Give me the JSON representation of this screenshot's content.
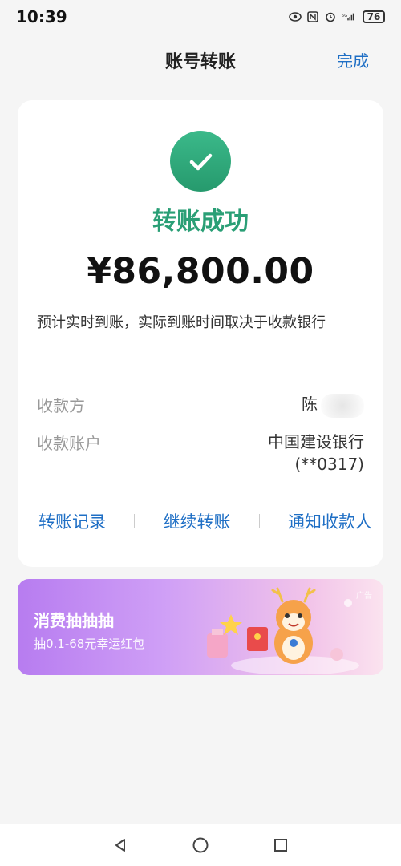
{
  "status_bar": {
    "time": "10:39",
    "network": "5G",
    "battery": "76"
  },
  "nav": {
    "title": "账号转账",
    "done_label": "完成"
  },
  "result": {
    "status_text": "转账成功",
    "amount": "¥86,800.00",
    "note": "预计实时到账，实际到账时间取决于收款银行"
  },
  "details": {
    "payee_label": "收款方",
    "payee_value": "陈",
    "account_label": "收款账户",
    "account_value": "中国建设银行(**0317)"
  },
  "actions": [
    {
      "label": "转账记录"
    },
    {
      "label": "继续转账"
    },
    {
      "label": "通知收款人"
    }
  ],
  "banner": {
    "title": "消费抽抽抽",
    "subtitle": "抽0.1-68元幸运红包",
    "ad_tag": "广告"
  },
  "colors": {
    "accent": "#1f6fc5",
    "success": "#2a9f76"
  }
}
